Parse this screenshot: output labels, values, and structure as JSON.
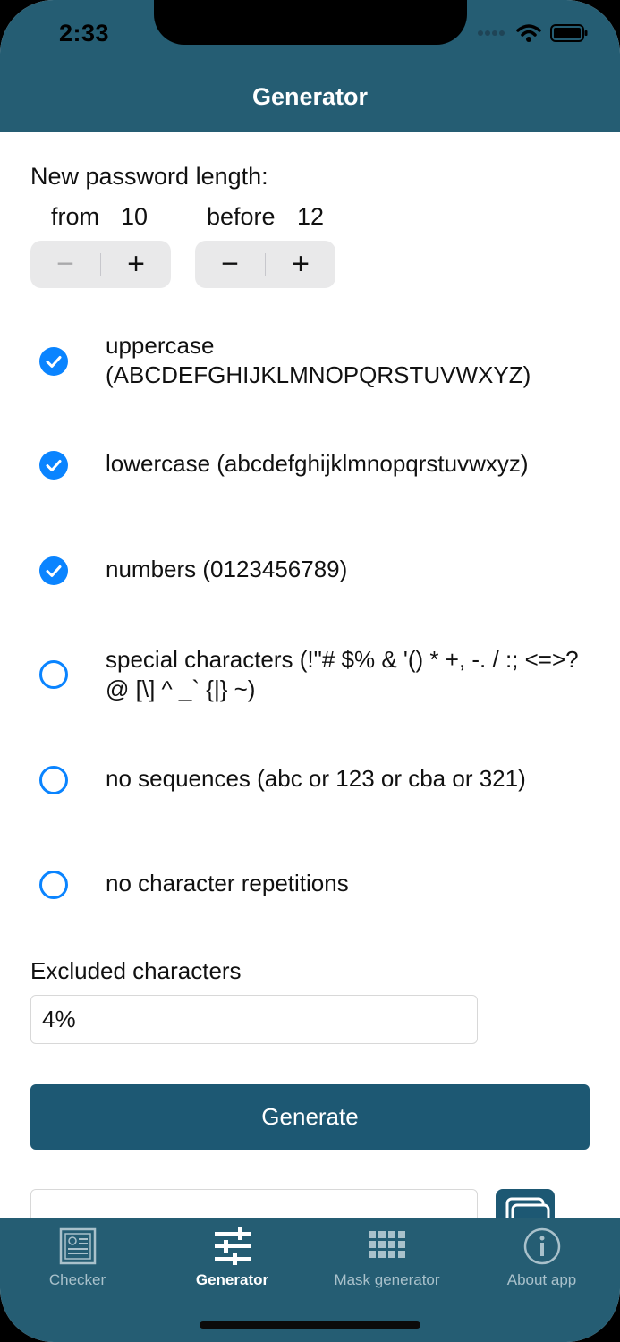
{
  "status": {
    "time": "2:33"
  },
  "nav": {
    "title": "Generator"
  },
  "length": {
    "label": "New password length:",
    "from_label": "from",
    "from_value": "10",
    "to_label": "before",
    "to_value": "12",
    "minus": "−",
    "plus": "+"
  },
  "options": [
    {
      "label": "uppercase (ABCDEFGHIJKLMNOPQRSTUVWXYZ)",
      "checked": true
    },
    {
      "label": "lowercase (abcdefghijklmnopqrstuvwxyz)",
      "checked": true
    },
    {
      "label": "numbers (0123456789)",
      "checked": true
    },
    {
      "label": "special characters (!\"# $% & '() * +, -. / :; <=>? @ [\\] ^ _` {|} ~)",
      "checked": false
    },
    {
      "label": "no sequences (abc or 123 or cba or 321)",
      "checked": false
    },
    {
      "label": "no character repetitions",
      "checked": false
    }
  ],
  "excluded": {
    "label": "Excluded characters",
    "value": "4%"
  },
  "generate_label": "Generate",
  "colors": {
    "header": "#255d73",
    "button": "#1d5873",
    "accent": "#0a84ff"
  },
  "tabs": [
    {
      "label": "Checker",
      "icon": "checker-icon",
      "active": false
    },
    {
      "label": "Generator",
      "icon": "sliders-icon",
      "active": true
    },
    {
      "label": "Mask generator",
      "icon": "grid-icon",
      "active": false
    },
    {
      "label": "About app",
      "icon": "info-icon",
      "active": false
    }
  ]
}
